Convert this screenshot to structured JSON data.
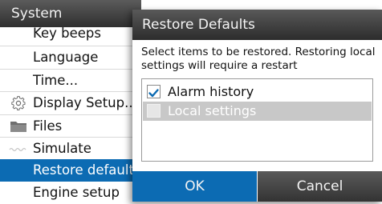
{
  "system_menu": {
    "title": "System",
    "items": [
      {
        "label": "Key beeps",
        "icon": null
      },
      {
        "label": "Language",
        "icon": null
      },
      {
        "label": "Time...",
        "icon": null
      },
      {
        "label": "Display Setup...",
        "icon": "gear-icon"
      },
      {
        "label": "Files",
        "icon": "folder-icon"
      },
      {
        "label": "Simulate",
        "icon": "simulate-icon"
      },
      {
        "label": "Restore defaults...",
        "icon": null,
        "selected": true
      },
      {
        "label": "Engine setup",
        "icon": null
      }
    ]
  },
  "dialog": {
    "title": "Restore Defaults",
    "description": "Select items to be restored. Restoring local settings will require a restart",
    "options": [
      {
        "label": "Alarm history",
        "checked": true
      },
      {
        "label": "Local settings",
        "checked": false,
        "highlighted": true
      }
    ],
    "ok_label": "OK",
    "cancel_label": "Cancel"
  },
  "colors": {
    "accent": "#0c6bb3",
    "header_dark": "#2f2f2f",
    "highlight_gray": "#c8c8c8"
  }
}
